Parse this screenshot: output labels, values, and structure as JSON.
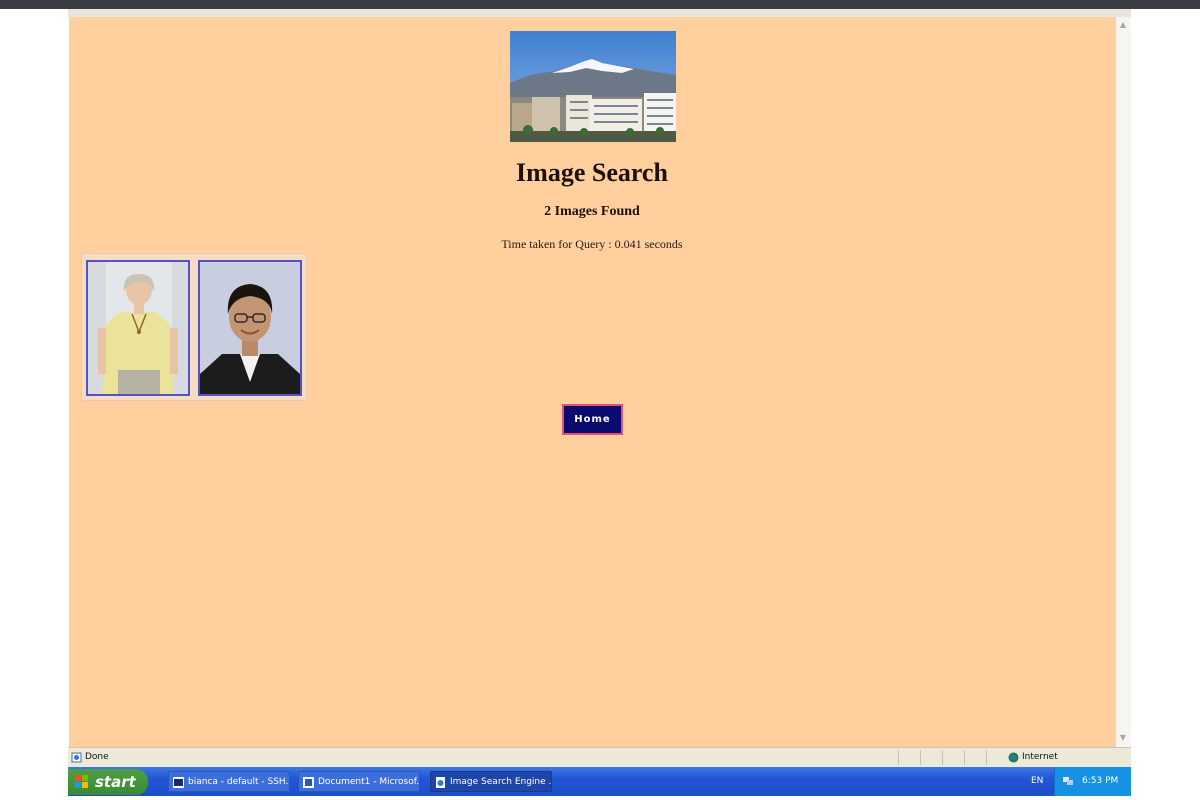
{
  "page": {
    "title": "Image Search",
    "result_count": "2 Images Found",
    "query_time": "Time taken for Query : 0.041 seconds",
    "home_button": "Home"
  },
  "results": [
    {
      "icon": "woman-portrait"
    },
    {
      "icon": "man-portrait"
    }
  ],
  "status_bar": {
    "status": "Done",
    "zone": "Internet"
  },
  "taskbar": {
    "start_label": "start",
    "tasks": [
      {
        "label": "bianca - default - SSH..."
      },
      {
        "label": "Document1 - Microsof..."
      },
      {
        "label": "Image Search Engine ..."
      }
    ],
    "language": "EN",
    "clock": "6:53 PM"
  },
  "colors": {
    "page_background": "#ffcf9e",
    "home_button": "#0c0a6e",
    "home_button_border": "#e5507a",
    "thumbnail_border": "#5552c2",
    "taskbar": "#2355d4"
  }
}
